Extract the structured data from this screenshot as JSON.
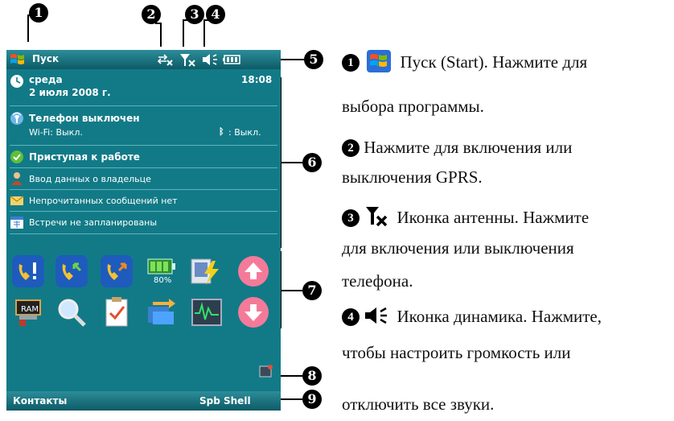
{
  "callouts": [
    "1",
    "2",
    "3",
    "4",
    "5",
    "6",
    "7",
    "8",
    "9"
  ],
  "phone": {
    "start_label": "Пуск",
    "date": {
      "day": "среда",
      "full_date": "2 июля 2008 г.",
      "time": "18:08"
    },
    "phone_status": {
      "title": "Телефон выключен",
      "wifi": "Wi-Fi: Выкл.",
      "bluetooth": ": Выкл."
    },
    "items": [
      {
        "label": "Приступая к работе",
        "icon": "getting-started-icon"
      },
      {
        "label": "Ввод данных о владельце",
        "icon": "owner-icon"
      },
      {
        "label": "Непрочитанных сообщений нет",
        "icon": "messages-icon"
      },
      {
        "label": "Встречи не запланированы",
        "icon": "calendar-icon"
      }
    ],
    "battery_percent": "80%",
    "softkeys": {
      "left": "Контакты",
      "right": "Spb Shell"
    },
    "colors": {
      "background": "#127a87",
      "bar": "#0d5b66"
    }
  },
  "descriptions": [
    {
      "num": "1",
      "lines": [
        "Пуск (Start). Нажмите для",
        "выбора программы."
      ]
    },
    {
      "num": "2",
      "lines": [
        "Нажмите для включения или",
        "выключения GPRS."
      ]
    },
    {
      "num": "3",
      "lines": [
        "Иконка антенны. Нажмите",
        "для включения или выключения",
        "телефона."
      ]
    },
    {
      "num": "4",
      "lines": [
        "Иконка динамика. Нажмите,",
        "чтобы настроить громкость или",
        "отключить все звуки."
      ]
    }
  ]
}
